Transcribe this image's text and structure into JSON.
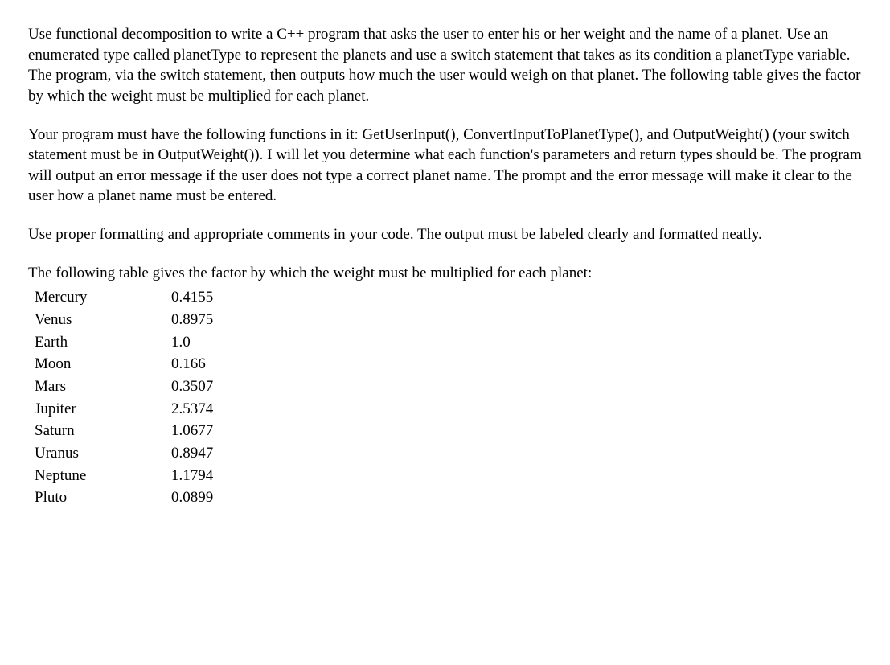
{
  "paragraphs": {
    "p1": "Use functional decomposition to write a C++ program that asks the user to enter his or her weight and the name of a planet. Use an enumerated type called planetType to represent the planets and use a switch statement that takes as its condition a planetType variable. The program, via the switch statement, then outputs how much the user would weigh on that planet. The following table gives the factor by which the weight must be multiplied for each planet.",
    "p2": "Your program must have the following functions in it: GetUserInput(), ConvertInputToPlanetType(), and OutputWeight() (your switch statement must be in OutputWeight()). I will let you determine what each function's parameters and return types should be. The program will output an error message if the user does not type a correct planet name. The prompt and the error message will make it clear to the user how a planet name must be entered.",
    "p3": "Use proper formatting and appropriate comments in your code. The output must be labeled clearly and formatted neatly.",
    "table_intro": "The following table gives the factor by which the weight must be multiplied for each planet:"
  },
  "planets": [
    {
      "name": "Mercury",
      "factor": "0.4155"
    },
    {
      "name": "Venus",
      "factor": "0.8975"
    },
    {
      "name": "Earth",
      "factor": "1.0"
    },
    {
      "name": "Moon",
      "factor": "0.166"
    },
    {
      "name": "Mars",
      "factor": "0.3507"
    },
    {
      "name": "Jupiter",
      "factor": "2.5374"
    },
    {
      "name": "Saturn",
      "factor": "1.0677"
    },
    {
      "name": "Uranus",
      "factor": "0.8947"
    },
    {
      "name": "Neptune",
      "factor": "1.1794"
    },
    {
      "name": "Pluto",
      "factor": "0.0899"
    }
  ]
}
